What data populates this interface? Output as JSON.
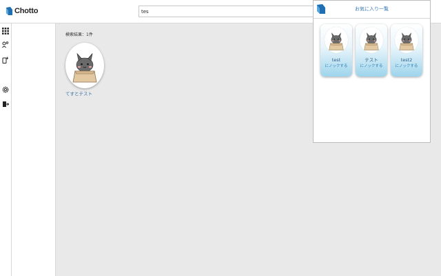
{
  "app": {
    "name": "Chotto"
  },
  "search": {
    "value": "tes"
  },
  "sidebar": {
    "icons": [
      "grid-icon",
      "user-key-icon",
      "device-add-icon",
      "gear-icon",
      "logout-icon"
    ]
  },
  "results": {
    "count_label": "検索結果：1件",
    "items": [
      {
        "name": "てすとテスト"
      }
    ]
  },
  "favorites": {
    "title": "お気に入り一覧",
    "items": [
      {
        "name": "test",
        "action": "にノックする"
      },
      {
        "name": "テスト",
        "action": "にノックする"
      },
      {
        "name": "test2",
        "action": "にノックする"
      }
    ]
  }
}
